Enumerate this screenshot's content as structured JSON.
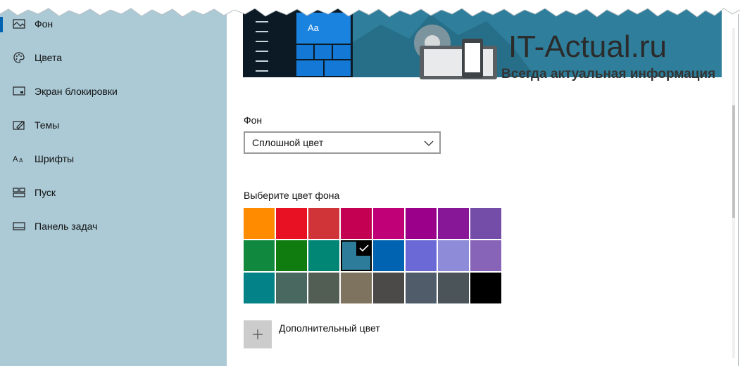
{
  "sidebar": {
    "items": [
      {
        "label": "Фон",
        "icon": "picture-icon",
        "selected": true
      },
      {
        "label": "Цвета",
        "icon": "palette-icon",
        "selected": false
      },
      {
        "label": "Экран блокировки",
        "icon": "lock-screen-icon",
        "selected": false
      },
      {
        "label": "Темы",
        "icon": "themes-icon",
        "selected": false
      },
      {
        "label": "Шрифты",
        "icon": "fonts-icon",
        "selected": false
      },
      {
        "label": "Пуск",
        "icon": "start-icon",
        "selected": false
      },
      {
        "label": "Панель задач",
        "icon": "taskbar-icon",
        "selected": false
      }
    ],
    "accent": "#0063b1"
  },
  "preview": {
    "tile_text": "Aa"
  },
  "watermark": {
    "title": "IT-Actual.ru",
    "subtitle": "Всегда актуальная информация"
  },
  "background": {
    "label": "Фон",
    "dropdown_value": "Сплошной цвет"
  },
  "color_picker": {
    "label": "Выберите цвет фона",
    "selected_index": 11,
    "colors": [
      "#ff8c00",
      "#e81123",
      "#d13438",
      "#c30052",
      "#bf0077",
      "#9a0089",
      "#881798",
      "#744da9",
      "#10893e",
      "#107c10",
      "#018574",
      "#2d7d9a",
      "#0063b1",
      "#6b69d6",
      "#8e8cd8",
      "#8764b8",
      "#038387",
      "#486860",
      "#525e54",
      "#7e735f",
      "#4c4a48",
      "#515c6b",
      "#4a5459",
      "#000000"
    ]
  },
  "custom_color": {
    "label": "Дополнительный цвет"
  }
}
